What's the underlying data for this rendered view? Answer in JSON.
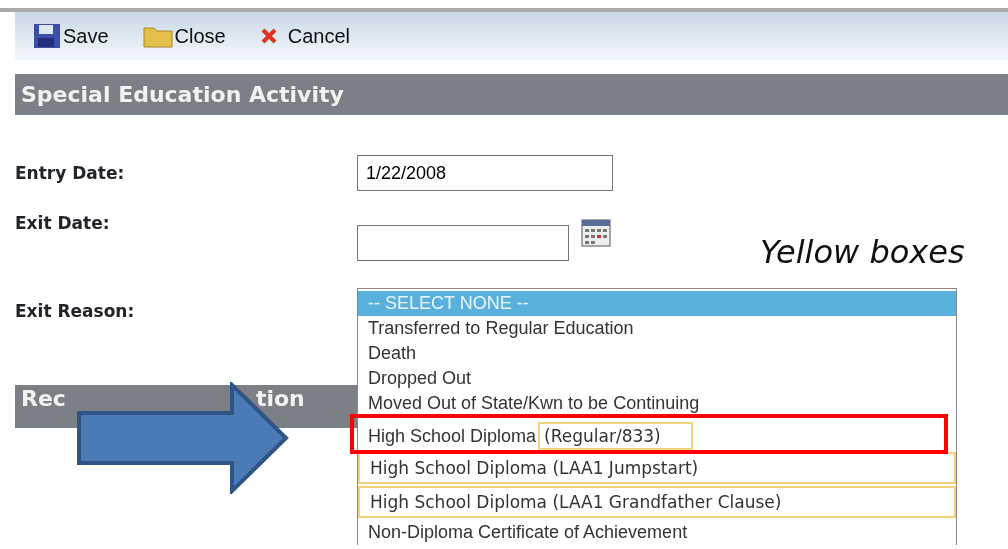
{
  "toolbar": {
    "buttons": [
      {
        "label": "Save",
        "kind": "save"
      },
      {
        "label": "Close",
        "kind": "folder"
      },
      {
        "label": "Cancel",
        "kind": "cancel"
      }
    ]
  },
  "section_title": "Special Education Activity",
  "fields": [
    {
      "label": "Entry Date:",
      "kind": "text",
      "value": "1/22/2008"
    },
    {
      "label": "Exit Date:",
      "kind": "date"
    },
    {
      "label": "Exit Reason:",
      "kind": "select"
    }
  ],
  "second_section_title_parts": [
    "Rec",
    "tion"
  ],
  "dropdown": {
    "options": [
      {
        "label": "-- SELECT NONE --",
        "selected": true,
        "highlighted": false
      },
      {
        "label": "Transferred to Regular Education",
        "selected": false,
        "highlighted": false
      },
      {
        "label": "Death",
        "selected": false,
        "highlighted": false
      },
      {
        "label": "Dropped Out",
        "selected": false,
        "highlighted": false
      },
      {
        "label": "Moved Out of State/Kwn to be Continuing",
        "selected": false,
        "highlighted": false
      },
      {
        "label": "High School Diploma",
        "tip": "(Regular/833)",
        "selected": false,
        "highlighted": false
      },
      {
        "label": "High School Diploma (LAA1 Jumpstart)",
        "selected": false,
        "highlighted": true
      },
      {
        "label": "High School Diploma (LAA1 Grandfather Clause)",
        "selected": false,
        "highlighted": true
      },
      {
        "label": "Non-Diploma Certificate of Achievement",
        "selected": false,
        "highlighted": false
      }
    ]
  },
  "annotation": {
    "text": "Yellow boxes"
  }
}
